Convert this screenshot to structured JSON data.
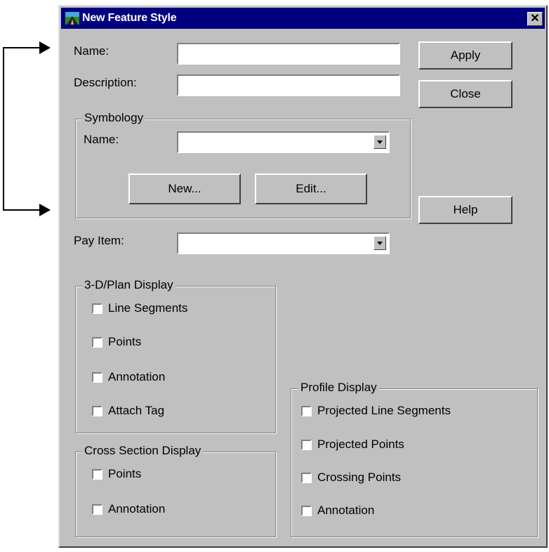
{
  "window": {
    "title": "New Feature Style",
    "close_glyph": "✕"
  },
  "labels": {
    "name": "Name:",
    "description": "Description:",
    "pay_item": "Pay Item:"
  },
  "fields": {
    "name": "",
    "description": "",
    "symbology_name": "",
    "pay_item": ""
  },
  "buttons": {
    "apply": "Apply",
    "close": "Close",
    "help": "Help",
    "new": "New...",
    "edit": "Edit..."
  },
  "symbology": {
    "title": "Symbology",
    "name_label": "Name:"
  },
  "plan_display": {
    "title": "3-D/Plan Display",
    "items": [
      "Line Segments",
      "Points",
      "Annotation",
      "Attach Tag"
    ]
  },
  "cross_section_display": {
    "title": "Cross Section Display",
    "items": [
      "Points",
      "Annotation"
    ]
  },
  "profile_display": {
    "title": "Profile Display",
    "items": [
      "Projected Line Segments",
      "Projected Points",
      "Crossing Points",
      "Annotation"
    ]
  },
  "icons": {
    "app": "app-icon",
    "dropdown": "chevron-down-icon",
    "arrow": "arrow-right-icon"
  }
}
